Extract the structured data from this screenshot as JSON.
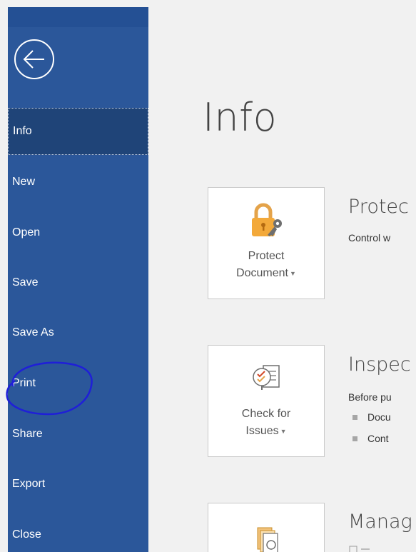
{
  "backstage": {
    "back_icon": "back-arrow-circle-icon",
    "nav_items": [
      {
        "label": "Info",
        "active": true
      },
      {
        "label": "New"
      },
      {
        "label": "Open"
      },
      {
        "label": "Save"
      },
      {
        "label": "Save As"
      },
      {
        "label": "Print"
      },
      {
        "label": "Share"
      },
      {
        "label": "Export"
      },
      {
        "label": "Close"
      }
    ],
    "annotation_color": "#0000ff"
  },
  "main": {
    "title": "Info",
    "tiles": [
      {
        "icon": "lock-key-icon",
        "line1": "Protect",
        "line2": "Document"
      },
      {
        "icon": "check-document-icon",
        "line1": "Check for",
        "line2": "Issues"
      },
      {
        "icon": "manage-versions-icon"
      }
    ],
    "sections": [
      {
        "heading": "Protec",
        "desc": "Control w"
      },
      {
        "heading": "Inspec",
        "desc": "Before pu",
        "bullets": [
          "Docu",
          "Cont"
        ]
      },
      {
        "heading": "Manag"
      }
    ]
  },
  "colors": {
    "sidebar": "#2b579a",
    "sidebar_active": "#1f4478",
    "background": "#f1f1f1",
    "lock_accent": "#f3a93a"
  }
}
